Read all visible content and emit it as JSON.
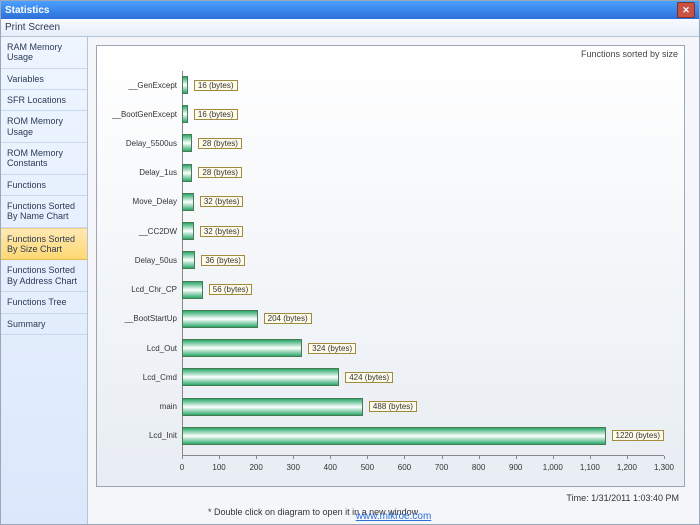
{
  "window": {
    "title": "Statistics"
  },
  "menu": {
    "print_screen": "Print Screen"
  },
  "sidebar": {
    "items": [
      {
        "label": "RAM Memory Usage"
      },
      {
        "label": "Variables"
      },
      {
        "label": "SFR Locations"
      },
      {
        "label": "ROM Memory Usage"
      },
      {
        "label": "ROM Memory Constants"
      },
      {
        "label": "Functions"
      },
      {
        "label": "Functions Sorted By Name Chart"
      },
      {
        "label": "Functions Sorted By Size Chart"
      },
      {
        "label": "Functions Sorted By Address Chart"
      },
      {
        "label": "Functions Tree"
      },
      {
        "label": "Summary"
      }
    ],
    "active_index": 7
  },
  "chart_data": {
    "type": "bar",
    "orientation": "horizontal",
    "title": "Functions sorted by size",
    "xlabel": "",
    "ylabel": "",
    "xlim": [
      0,
      1300
    ],
    "xticks": [
      0,
      100,
      200,
      300,
      400,
      500,
      600,
      700,
      800,
      900,
      1000,
      1100,
      1200,
      1300
    ],
    "unit": "bytes",
    "categories": [
      "__GenExcept",
      "__BootGenExcept",
      "Delay_5500us",
      "Delay_1us",
      "Move_Delay",
      "__CC2DW",
      "Delay_50us",
      "Lcd_Chr_CP",
      "__BootStartUp",
      "Lcd_Out",
      "Lcd_Cmd",
      "main",
      "Lcd_Init"
    ],
    "values": [
      16,
      16,
      28,
      28,
      32,
      32,
      36,
      56,
      204,
      324,
      424,
      488,
      1220
    ],
    "value_labels": [
      "16 (bytes)",
      "16 (bytes)",
      "28 (bytes)",
      "28 (bytes)",
      "32 (bytes)",
      "32 (bytes)",
      "36 (bytes)",
      "56 (bytes)",
      "204 (bytes)",
      "324 (bytes)",
      "424 (bytes)",
      "488 (bytes)",
      "1220 (bytes)"
    ]
  },
  "hint": "* Double click on diagram to open it in a new window",
  "status": {
    "time_label": "Time: 1/31/2011 1:03:40 PM"
  },
  "footer": {
    "link_text": "www.mikroe.com"
  }
}
